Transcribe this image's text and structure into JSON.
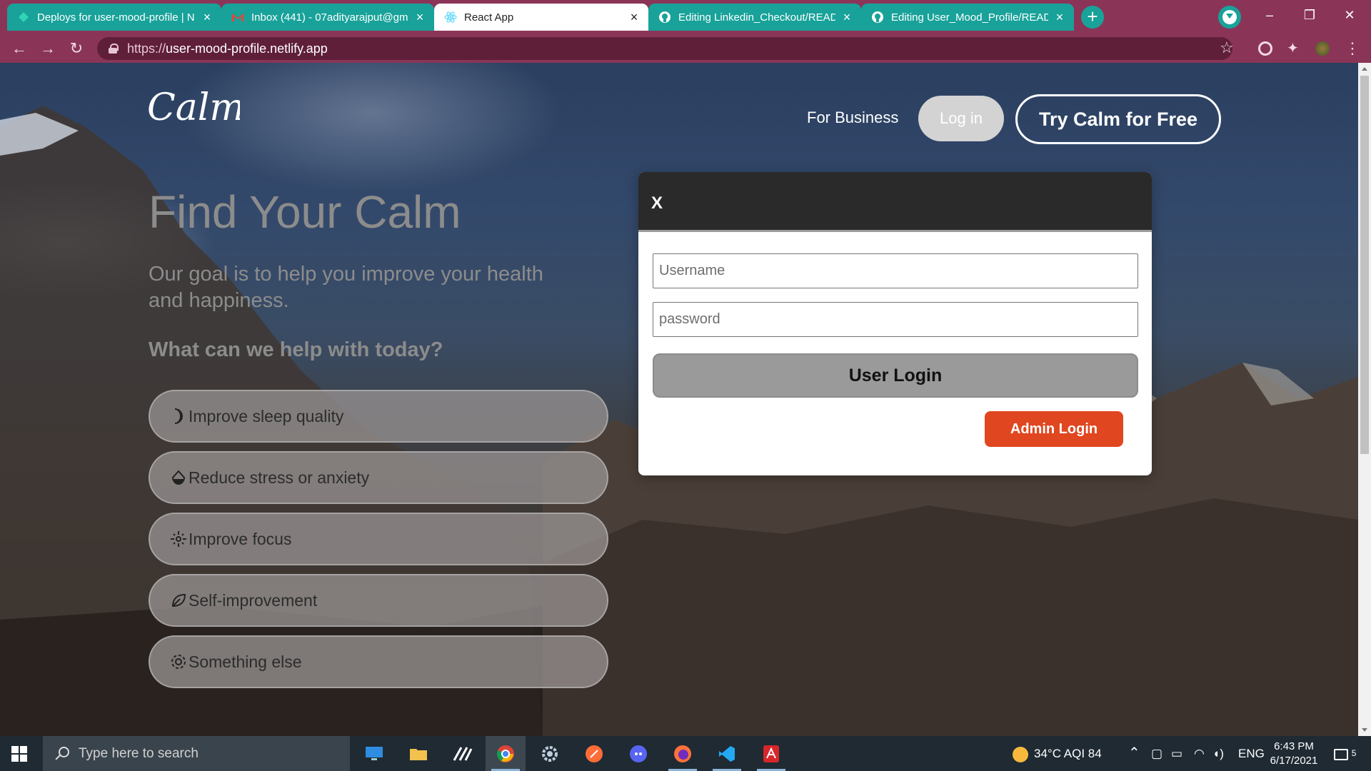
{
  "browser": {
    "tabs": [
      {
        "title": "Deploys for user-mood-profile | N",
        "active": false
      },
      {
        "title": "Inbox (441) - 07adityarajput@gm",
        "active": false
      },
      {
        "title": "React App",
        "active": true
      },
      {
        "title": "Editing Linkedin_Checkout/READ",
        "active": false
      },
      {
        "title": "Editing User_Mood_Profile/READ",
        "active": false
      }
    ],
    "url_scheme": "https://",
    "url_host": "user-mood-profile.netlify.app",
    "colors": {
      "frame": "#8a3557",
      "tab_group": "#18a29a"
    }
  },
  "header": {
    "logo_text": "Calm",
    "for_business": "For Business",
    "login_label": "Log in",
    "try_label": "Try Calm for Free"
  },
  "hero": {
    "title": "Find Your Calm",
    "subtitle": "Our goal is to help you improve your health and happiness.",
    "question": "What can we help with today?",
    "options": [
      {
        "label": "Improve sleep quality",
        "icon": "moon-icon"
      },
      {
        "label": "Reduce stress or anxiety",
        "icon": "drop-icon"
      },
      {
        "label": "Improve focus",
        "icon": "focus-icon"
      },
      {
        "label": "Self-improvement",
        "icon": "leaf-icon"
      },
      {
        "label": "Something else",
        "icon": "gear-icon"
      }
    ]
  },
  "modal": {
    "close_label": "X",
    "username_placeholder": "Username",
    "password_placeholder": "password",
    "user_login_label": "User Login",
    "admin_login_label": "Admin Login",
    "colors": {
      "admin": "#e0461f",
      "header": "#2a2a2a"
    }
  },
  "taskbar": {
    "search_placeholder": "Type here to search",
    "weather": "34°C  AQI 84",
    "language": "ENG",
    "time": "6:43 PM",
    "date": "6/17/2021",
    "notification_count": "5"
  }
}
